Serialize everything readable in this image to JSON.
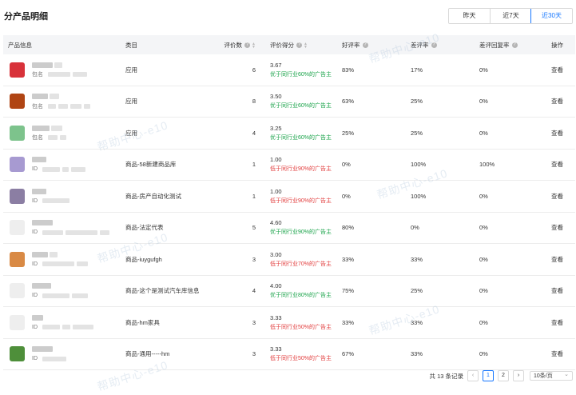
{
  "page_title": "分产品明细",
  "time_filters": [
    {
      "label": "昨天",
      "active": false
    },
    {
      "label": "近7天",
      "active": false
    },
    {
      "label": "近30天",
      "active": true
    }
  ],
  "columns": {
    "product": "产品信息",
    "category": "类目",
    "review_count": "评价数",
    "rating_score": "评价得分",
    "positive_rate": "好评率",
    "negative_rate": "差评率",
    "negative_reply_rate": "差评回复率",
    "action": "操作"
  },
  "rows": [
    {
      "sub_label": "包名",
      "category": "应用",
      "reviews": "6",
      "score": "3.67",
      "desc": "优于同行业60%的广告主",
      "tone": "good",
      "pos": "83%",
      "neg": "17%",
      "reply": "0%",
      "action": "查看",
      "thumb": "#d8323a"
    },
    {
      "sub_label": "包名",
      "category": "应用",
      "reviews": "8",
      "score": "3.50",
      "desc": "优于同行业60%的广告主",
      "tone": "good",
      "pos": "63%",
      "neg": "25%",
      "reply": "0%",
      "action": "查看",
      "thumb": "#b04514"
    },
    {
      "sub_label": "包名",
      "category": "应用",
      "reviews": "4",
      "score": "3.25",
      "desc": "优于同行业60%的广告主",
      "tone": "good",
      "pos": "25%",
      "neg": "25%",
      "reply": "0%",
      "action": "查看",
      "thumb": "#7dc38c"
    },
    {
      "sub_label": "ID",
      "category": "商品-58新建商品库",
      "reviews": "1",
      "score": "1.00",
      "desc": "低于同行业90%的广告主",
      "tone": "bad",
      "pos": "0%",
      "neg": "100%",
      "reply": "100%",
      "action": "查看",
      "thumb": "#a79ad1"
    },
    {
      "sub_label": "ID",
      "category": "商品-房产自动化测试",
      "reviews": "1",
      "score": "1.00",
      "desc": "低于同行业90%的广告主",
      "tone": "bad",
      "pos": "0%",
      "neg": "100%",
      "reply": "0%",
      "action": "查看",
      "thumb": "#8b7ea3"
    },
    {
      "sub_label": "ID",
      "category": "商品-法定代表",
      "reviews": "5",
      "score": "4.60",
      "desc": "优于同行业90%的广告主",
      "tone": "good",
      "pos": "80%",
      "neg": "0%",
      "reply": "0%",
      "action": "查看",
      "thumb": "#eeeeee"
    },
    {
      "sub_label": "ID",
      "category": "商品-iuygufgh",
      "reviews": "3",
      "score": "3.00",
      "desc": "低于同行业70%的广告主",
      "tone": "bad",
      "pos": "33%",
      "neg": "33%",
      "reply": "0%",
      "action": "查看",
      "thumb": "#d98a45"
    },
    {
      "sub_label": "ID",
      "category": "商品-这个是测试汽车库信息",
      "reviews": "4",
      "score": "4.00",
      "desc": "优于同行业80%的广告主",
      "tone": "good",
      "pos": "75%",
      "neg": "25%",
      "reply": "0%",
      "action": "查看",
      "thumb": "#eeeeee"
    },
    {
      "sub_label": "ID",
      "category": "商品-hm家具",
      "reviews": "3",
      "score": "3.33",
      "desc": "低于同行业50%的广告主",
      "tone": "bad",
      "pos": "33%",
      "neg": "33%",
      "reply": "0%",
      "action": "查看",
      "thumb": "#eeeeee"
    },
    {
      "sub_label": "ID",
      "category": "商品-通用-----hm",
      "reviews": "3",
      "score": "3.33",
      "desc": "低于同行业50%的广告主",
      "tone": "bad",
      "pos": "67%",
      "neg": "33%",
      "reply": "0%",
      "action": "查看",
      "thumb": "#4e8f3a"
    }
  ],
  "pagination": {
    "total_text": "共 13 条记录",
    "prev_icon": "‹",
    "pages": [
      "1",
      "2"
    ],
    "current": "1",
    "next_icon": "›",
    "page_size": "10条/页"
  },
  "watermark": "帮助中心-e10",
  "colors": {
    "accent": "#1677ff",
    "good": "#1aa34a",
    "bad": "#e23c3c",
    "header_bg": "#f4f5f7"
  }
}
